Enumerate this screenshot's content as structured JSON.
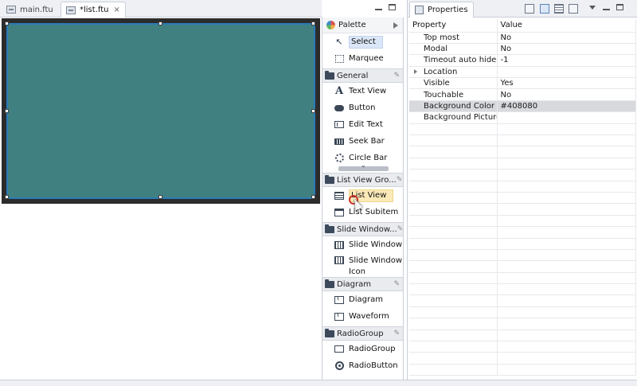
{
  "editor": {
    "tabs": [
      {
        "label": "main.ftu",
        "active": false
      },
      {
        "label": "*list.ftu",
        "active": true
      }
    ],
    "close_glyph": "⨯",
    "canvas": {
      "background_color": "#408080",
      "frame_color": "#2c2c2c",
      "selection_color": "#2a7ab8"
    }
  },
  "palette": {
    "title": "Palette",
    "tools": [
      {
        "label": "Select",
        "icon": "cursor-icon",
        "selected": true
      },
      {
        "label": "Marquee",
        "icon": "marquee-icon",
        "selected": false
      }
    ],
    "groups": [
      {
        "label": "General",
        "items": [
          {
            "label": "Text View",
            "icon": "text-view-icon"
          },
          {
            "label": "Button",
            "icon": "button-icon"
          },
          {
            "label": "Edit Text",
            "icon": "edit-text-icon"
          },
          {
            "label": "Seek Bar",
            "icon": "seek-bar-icon"
          },
          {
            "label": "Circle Bar",
            "icon": "circle-bar-icon"
          }
        ]
      },
      {
        "label": "List View Gro...",
        "items": [
          {
            "label": "List View",
            "icon": "list-view-icon",
            "hover": true
          },
          {
            "label": "List Subitem",
            "icon": "list-subitem-icon"
          }
        ]
      },
      {
        "label": "Slide Window...",
        "items": [
          {
            "label": "Slide Window",
            "icon": "slide-window-icon"
          },
          {
            "label": "Slide Window Icon",
            "line1": "Slide Window",
            "line2": "Icon",
            "icon": "slide-window-icon-icon"
          }
        ]
      },
      {
        "label": "Diagram",
        "items": [
          {
            "label": "Diagram",
            "icon": "diagram-icon"
          },
          {
            "label": "Waveform",
            "icon": "waveform-icon"
          }
        ]
      },
      {
        "label": "RadioGroup",
        "items": [
          {
            "label": "RadioGroup",
            "icon": "radio-group-icon"
          },
          {
            "label": "RadioButton",
            "icon": "radio-button-icon"
          }
        ]
      }
    ]
  },
  "properties": {
    "title": "Properties",
    "columns": {
      "property": "Property",
      "value": "Value"
    },
    "rows": [
      {
        "name": "Top most",
        "value": "No"
      },
      {
        "name": "Modal",
        "value": "No"
      },
      {
        "name": "Timeout auto hide",
        "value": "-1"
      },
      {
        "name": "Location",
        "value": "",
        "expandable": true
      },
      {
        "name": "Visible",
        "value": "Yes"
      },
      {
        "name": "Touchable",
        "value": "No"
      },
      {
        "name": "Background Color",
        "value": "#408080",
        "selected": true
      },
      {
        "name": "Background Picture",
        "value": ""
      }
    ]
  }
}
